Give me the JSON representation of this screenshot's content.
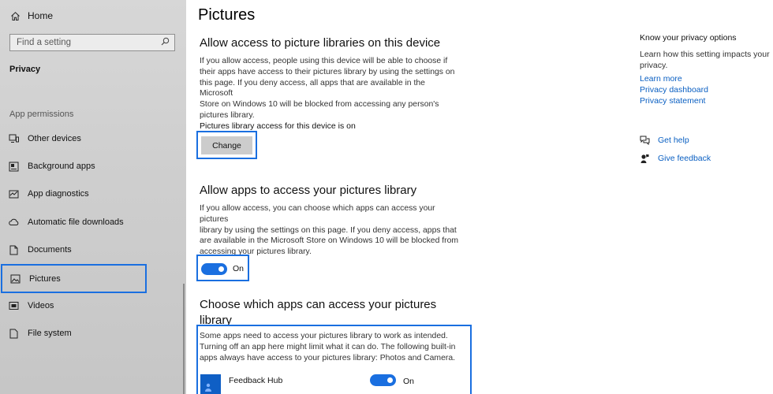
{
  "sidebar": {
    "home_label": "Home",
    "search_placeholder": "Find a setting",
    "section": "Privacy",
    "permissions_label": "App permissions",
    "items": [
      {
        "label": "Other devices",
        "icon": "devices-icon"
      },
      {
        "label": "Background apps",
        "icon": "background-apps-icon"
      },
      {
        "label": "App diagnostics",
        "icon": "diagnostics-icon"
      },
      {
        "label": "Automatic file downloads",
        "icon": "cloud-icon"
      },
      {
        "label": "Documents",
        "icon": "document-icon"
      },
      {
        "label": "Pictures",
        "icon": "picture-icon",
        "selected": true
      },
      {
        "label": "Videos",
        "icon": "video-icon"
      },
      {
        "label": "File system",
        "icon": "file-icon"
      }
    ]
  },
  "main": {
    "title": "Pictures",
    "section1": {
      "heading": "Allow access to picture libraries on this device",
      "lines": [
        "If you allow access, people using this device will be able to choose if",
        "their apps have access to their pictures library by using the settings on",
        "this page. If you deny access, all apps that are available in the Microsoft",
        "Store on Windows 10 will be blocked from accessing any person's",
        "pictures library."
      ],
      "status": "Pictures library access for this device is on",
      "button": "Change"
    },
    "section2": {
      "heading": "Allow apps to access your pictures library",
      "lines": [
        "If you allow access, you can choose which apps can access your pictures",
        "library by using the settings on this page. If you deny access, apps that",
        "are available in the Microsoft Store on Windows 10 will be blocked from",
        "accessing your pictures library."
      ],
      "toggle_label": "On",
      "toggle_on": true
    },
    "section3": {
      "heading_line1": "Choose which apps can access your pictures",
      "heading_line2": "library",
      "lines": [
        "Some apps need to access your pictures library to work as intended.",
        "Turning off an app here might limit what it can do. The following built-in",
        "apps always have access to your pictures library: Photos and Camera."
      ],
      "apps": [
        {
          "name": "Feedback Hub",
          "toggle_label": "On",
          "toggle_on": true
        }
      ]
    }
  },
  "right": {
    "title": "Know your privacy options",
    "desc": "Learn how this setting impacts your privacy.",
    "links": [
      "Learn more",
      "Privacy dashboard",
      "Privacy statement"
    ],
    "help": {
      "label": "Get help",
      "icon": "chat-help-icon"
    },
    "feedback": {
      "label": "Give feedback",
      "icon": "feedback-icon"
    }
  },
  "colors": {
    "accent": "#1a6fe0",
    "link": "#0a5fc2",
    "sidebar_bg": "#cfcfcf"
  }
}
